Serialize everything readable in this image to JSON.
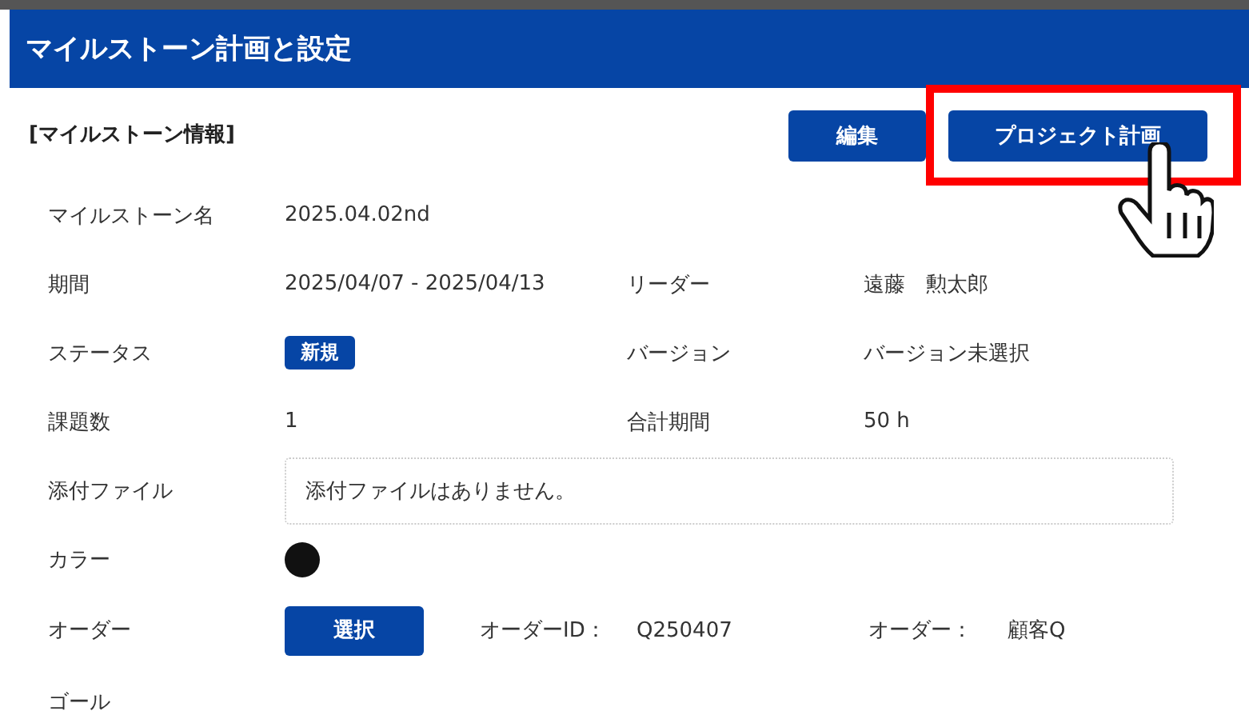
{
  "header": {
    "title": "マイルストーン計画と設定"
  },
  "section": {
    "title": "[マイルストーン情報]",
    "buttons": [
      {
        "label": "編集",
        "highlighted": false
      },
      {
        "label": "プロジェクト計画",
        "highlighted": true
      }
    ]
  },
  "fields": [
    {
      "kind": "text",
      "label": "マイルストーン名",
      "value": "2025.04.02nd"
    },
    {
      "kind": "pair",
      "label": "期間",
      "value": "2025/04/07 - 2025/04/13",
      "label2": "リーダー",
      "value2": "遠藤　勲太郎"
    },
    {
      "kind": "badge",
      "label": "ステータス",
      "value": "新規",
      "label2": "バージョン",
      "value2": "バージョン未選択"
    },
    {
      "kind": "pair",
      "label": "課題数",
      "value": "1",
      "label2": "合計期間",
      "value2": "50 h"
    },
    {
      "kind": "box",
      "label": "添付ファイル",
      "value": "添付ファイルはありません。"
    },
    {
      "kind": "color",
      "label": "カラー",
      "color": "#111111"
    },
    {
      "kind": "order",
      "label": "オーダー",
      "button": "選択",
      "id_label": "オーダーID：",
      "id": "Q250407",
      "order_label": "オーダー：",
      "order": "顧客Q"
    },
    {
      "kind": "text",
      "label": "ゴール"
    }
  ]
}
